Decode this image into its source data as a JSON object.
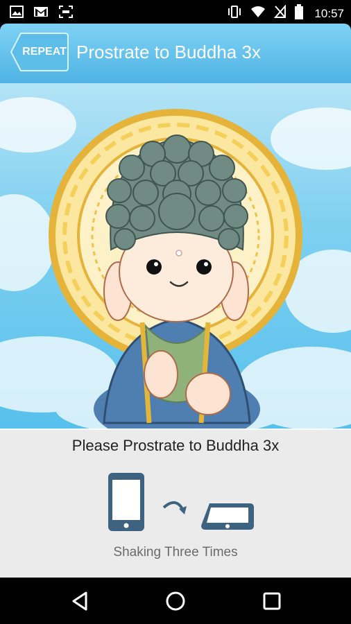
{
  "status_bar": {
    "time": "10:57",
    "left_icons": [
      "image-icon",
      "gmail-icon",
      "screenshot-icon"
    ],
    "right_icons": [
      "vibrate-icon",
      "wifi-icon",
      "no-sim-icon",
      "battery-icon"
    ]
  },
  "header": {
    "repeat_label": "REPEAT",
    "title": "Prostrate to Buddha 3x"
  },
  "main": {
    "instruction": "Please Prostrate to Buddha 3x",
    "shake_caption": "Shaking Three Times"
  },
  "nav_bar": {
    "buttons": [
      "back-icon",
      "home-icon",
      "recents-icon"
    ]
  },
  "colors": {
    "header_top": "#7fd2f4",
    "header_bottom": "#4fb3e4",
    "device_icon": "#3e6380",
    "halo_gold": "#e6b33a",
    "hair": "#6f8b84",
    "robe_blue": "#4f7fb0",
    "robe_green": "#8fb27a"
  }
}
